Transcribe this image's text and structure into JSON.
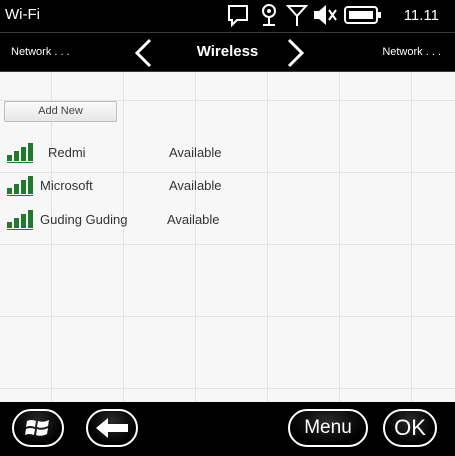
{
  "status": {
    "title": "Wi-Fi",
    "time": "11.11",
    "icons": [
      "chat-icon",
      "antenna-icon",
      "signal-icon",
      "speaker-mute-icon",
      "battery-icon"
    ]
  },
  "nav": {
    "left_label": "Network . . .",
    "title": "Wireless",
    "right_label": "Network . . ."
  },
  "actions": {
    "add_new": "Add New"
  },
  "networks": [
    {
      "name": "Redmi",
      "status": "Available"
    },
    {
      "name": "Microsoft",
      "status": "Available"
    },
    {
      "name": "Guding Guding",
      "status": "Available"
    }
  ],
  "softkeys": {
    "menu": "Menu",
    "ok": "OK"
  },
  "colors": {
    "signal": "#1f7a2e",
    "bar_background": "#000000"
  }
}
